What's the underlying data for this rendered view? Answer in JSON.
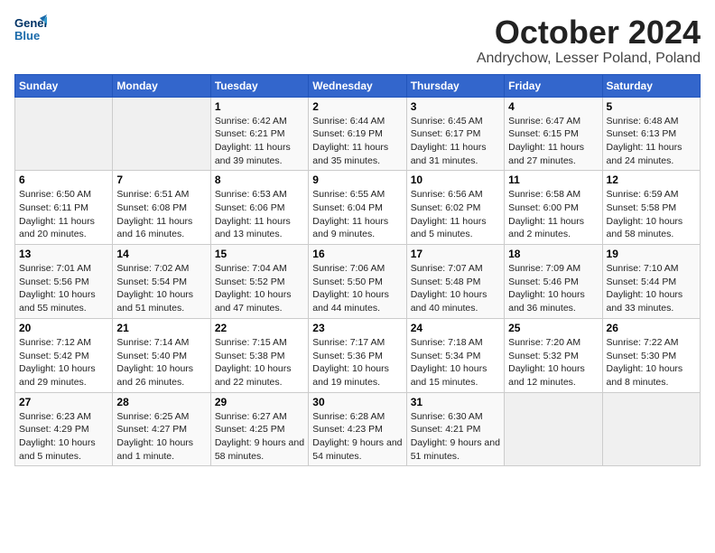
{
  "header": {
    "logo_line1": "General",
    "logo_line2": "Blue",
    "month": "October 2024",
    "location": "Andrychow, Lesser Poland, Poland"
  },
  "days_of_week": [
    "Sunday",
    "Monday",
    "Tuesday",
    "Wednesday",
    "Thursday",
    "Friday",
    "Saturday"
  ],
  "weeks": [
    [
      {
        "day": "",
        "sunrise": "",
        "sunset": "",
        "daylight": ""
      },
      {
        "day": "",
        "sunrise": "",
        "sunset": "",
        "daylight": ""
      },
      {
        "day": "1",
        "sunrise": "Sunrise: 6:42 AM",
        "sunset": "Sunset: 6:21 PM",
        "daylight": "Daylight: 11 hours and 39 minutes."
      },
      {
        "day": "2",
        "sunrise": "Sunrise: 6:44 AM",
        "sunset": "Sunset: 6:19 PM",
        "daylight": "Daylight: 11 hours and 35 minutes."
      },
      {
        "day": "3",
        "sunrise": "Sunrise: 6:45 AM",
        "sunset": "Sunset: 6:17 PM",
        "daylight": "Daylight: 11 hours and 31 minutes."
      },
      {
        "day": "4",
        "sunrise": "Sunrise: 6:47 AM",
        "sunset": "Sunset: 6:15 PM",
        "daylight": "Daylight: 11 hours and 27 minutes."
      },
      {
        "day": "5",
        "sunrise": "Sunrise: 6:48 AM",
        "sunset": "Sunset: 6:13 PM",
        "daylight": "Daylight: 11 hours and 24 minutes."
      }
    ],
    [
      {
        "day": "6",
        "sunrise": "Sunrise: 6:50 AM",
        "sunset": "Sunset: 6:11 PM",
        "daylight": "Daylight: 11 hours and 20 minutes."
      },
      {
        "day": "7",
        "sunrise": "Sunrise: 6:51 AM",
        "sunset": "Sunset: 6:08 PM",
        "daylight": "Daylight: 11 hours and 16 minutes."
      },
      {
        "day": "8",
        "sunrise": "Sunrise: 6:53 AM",
        "sunset": "Sunset: 6:06 PM",
        "daylight": "Daylight: 11 hours and 13 minutes."
      },
      {
        "day": "9",
        "sunrise": "Sunrise: 6:55 AM",
        "sunset": "Sunset: 6:04 PM",
        "daylight": "Daylight: 11 hours and 9 minutes."
      },
      {
        "day": "10",
        "sunrise": "Sunrise: 6:56 AM",
        "sunset": "Sunset: 6:02 PM",
        "daylight": "Daylight: 11 hours and 5 minutes."
      },
      {
        "day": "11",
        "sunrise": "Sunrise: 6:58 AM",
        "sunset": "Sunset: 6:00 PM",
        "daylight": "Daylight: 11 hours and 2 minutes."
      },
      {
        "day": "12",
        "sunrise": "Sunrise: 6:59 AM",
        "sunset": "Sunset: 5:58 PM",
        "daylight": "Daylight: 10 hours and 58 minutes."
      }
    ],
    [
      {
        "day": "13",
        "sunrise": "Sunrise: 7:01 AM",
        "sunset": "Sunset: 5:56 PM",
        "daylight": "Daylight: 10 hours and 55 minutes."
      },
      {
        "day": "14",
        "sunrise": "Sunrise: 7:02 AM",
        "sunset": "Sunset: 5:54 PM",
        "daylight": "Daylight: 10 hours and 51 minutes."
      },
      {
        "day": "15",
        "sunrise": "Sunrise: 7:04 AM",
        "sunset": "Sunset: 5:52 PM",
        "daylight": "Daylight: 10 hours and 47 minutes."
      },
      {
        "day": "16",
        "sunrise": "Sunrise: 7:06 AM",
        "sunset": "Sunset: 5:50 PM",
        "daylight": "Daylight: 10 hours and 44 minutes."
      },
      {
        "day": "17",
        "sunrise": "Sunrise: 7:07 AM",
        "sunset": "Sunset: 5:48 PM",
        "daylight": "Daylight: 10 hours and 40 minutes."
      },
      {
        "day": "18",
        "sunrise": "Sunrise: 7:09 AM",
        "sunset": "Sunset: 5:46 PM",
        "daylight": "Daylight: 10 hours and 36 minutes."
      },
      {
        "day": "19",
        "sunrise": "Sunrise: 7:10 AM",
        "sunset": "Sunset: 5:44 PM",
        "daylight": "Daylight: 10 hours and 33 minutes."
      }
    ],
    [
      {
        "day": "20",
        "sunrise": "Sunrise: 7:12 AM",
        "sunset": "Sunset: 5:42 PM",
        "daylight": "Daylight: 10 hours and 29 minutes."
      },
      {
        "day": "21",
        "sunrise": "Sunrise: 7:14 AM",
        "sunset": "Sunset: 5:40 PM",
        "daylight": "Daylight: 10 hours and 26 minutes."
      },
      {
        "day": "22",
        "sunrise": "Sunrise: 7:15 AM",
        "sunset": "Sunset: 5:38 PM",
        "daylight": "Daylight: 10 hours and 22 minutes."
      },
      {
        "day": "23",
        "sunrise": "Sunrise: 7:17 AM",
        "sunset": "Sunset: 5:36 PM",
        "daylight": "Daylight: 10 hours and 19 minutes."
      },
      {
        "day": "24",
        "sunrise": "Sunrise: 7:18 AM",
        "sunset": "Sunset: 5:34 PM",
        "daylight": "Daylight: 10 hours and 15 minutes."
      },
      {
        "day": "25",
        "sunrise": "Sunrise: 7:20 AM",
        "sunset": "Sunset: 5:32 PM",
        "daylight": "Daylight: 10 hours and 12 minutes."
      },
      {
        "day": "26",
        "sunrise": "Sunrise: 7:22 AM",
        "sunset": "Sunset: 5:30 PM",
        "daylight": "Daylight: 10 hours and 8 minutes."
      }
    ],
    [
      {
        "day": "27",
        "sunrise": "Sunrise: 6:23 AM",
        "sunset": "Sunset: 4:29 PM",
        "daylight": "Daylight: 10 hours and 5 minutes."
      },
      {
        "day": "28",
        "sunrise": "Sunrise: 6:25 AM",
        "sunset": "Sunset: 4:27 PM",
        "daylight": "Daylight: 10 hours and 1 minute."
      },
      {
        "day": "29",
        "sunrise": "Sunrise: 6:27 AM",
        "sunset": "Sunset: 4:25 PM",
        "daylight": "Daylight: 9 hours and 58 minutes."
      },
      {
        "day": "30",
        "sunrise": "Sunrise: 6:28 AM",
        "sunset": "Sunset: 4:23 PM",
        "daylight": "Daylight: 9 hours and 54 minutes."
      },
      {
        "day": "31",
        "sunrise": "Sunrise: 6:30 AM",
        "sunset": "Sunset: 4:21 PM",
        "daylight": "Daylight: 9 hours and 51 minutes."
      },
      {
        "day": "",
        "sunrise": "",
        "sunset": "",
        "daylight": ""
      },
      {
        "day": "",
        "sunrise": "",
        "sunset": "",
        "daylight": ""
      }
    ]
  ]
}
